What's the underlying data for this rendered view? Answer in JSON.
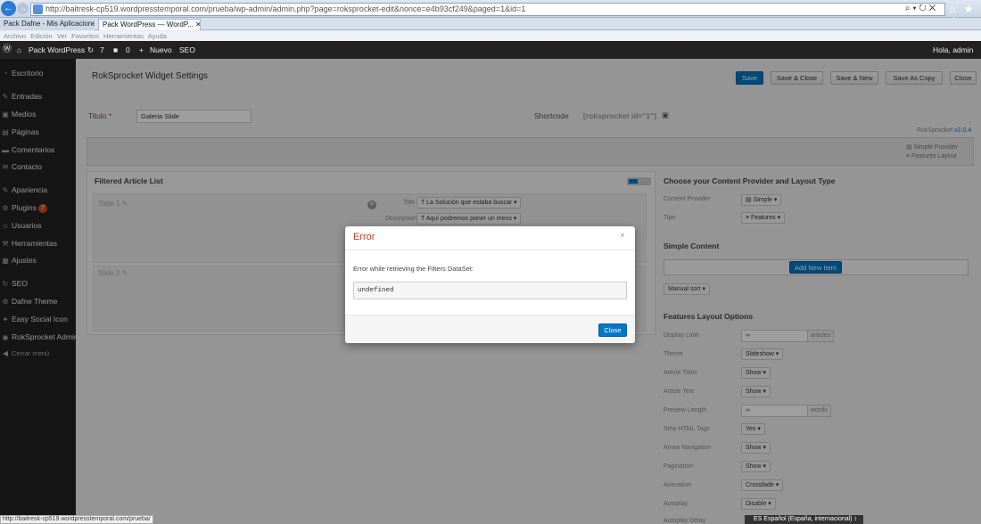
{
  "browser": {
    "url": "http://baitresk-cp519.wordpresstemporal.com/prueba/wp-admin/admin.php?page=roksprocket-edit&nonce=e4b93cf249&paged=1&id=1",
    "url_tools": "⌕ ▾ ↻ ✕",
    "right_icons": "⌂ ★ ⚙",
    "tabs": [
      {
        "label": "Pack Dafne - Mis Aplicaciones ..."
      },
      {
        "label": "Pack WordPress — WordP... ✕"
      }
    ],
    "menu": "Archivo Edición Ver Favoritos Herramientas Ayuda",
    "status_url": "http://baitresk-cp519.wordpresstemporal.com/prueba/"
  },
  "admin_bar": {
    "site_name": "Pack WordPress",
    "updates_count": "7",
    "comments_count": "0",
    "new_label": "Nuevo",
    "seo_label": "SEO",
    "greeting": "Hola, admin"
  },
  "sidebar": {
    "items": [
      {
        "label": "Escritorio",
        "icon": "◔"
      },
      {
        "label": "Entradas",
        "icon": "✎"
      },
      {
        "label": "Medios",
        "icon": "▣"
      },
      {
        "label": "Páginas",
        "icon": "▤"
      },
      {
        "label": "Comentarios",
        "icon": "▬"
      },
      {
        "label": "Contacto",
        "icon": "✉"
      },
      {
        "label": "Apariencia",
        "icon": "✎"
      },
      {
        "label": "Plugins",
        "icon": "⚙",
        "badge": "7"
      },
      {
        "label": "Usuarios",
        "icon": "☺"
      },
      {
        "label": "Herramientas",
        "icon": "⚒"
      },
      {
        "label": "Ajustes",
        "icon": "▦"
      },
      {
        "label": "SEO",
        "icon": "↻"
      },
      {
        "label": "Dafne Theme",
        "icon": "⚙"
      },
      {
        "label": "Easy Social Icon",
        "icon": "✦"
      },
      {
        "label": "RokSprocket Admin",
        "icon": "◉"
      },
      {
        "label": "Cerrar menú",
        "icon": "◀"
      }
    ]
  },
  "page": {
    "title": "RokSprocket Widget Settings",
    "buttons": {
      "save": "Save",
      "save_close": "Save & Close",
      "save_new": "Save & New",
      "save_copy": "Save As Copy",
      "close": "Close"
    },
    "title_label": "Titulo",
    "title_required": "*",
    "title_value": "Galeria Slide",
    "shortcode_label": "Shortcode",
    "shortcode_value": "[roksprocket id=\"1\"]",
    "version_brand": "RokSprocket",
    "version": "v2.0.4",
    "provider_badge": "Simple Provider",
    "layout_badge": "Features Layout"
  },
  "article_list": {
    "title": "Filtered Article List",
    "slides": [
      {
        "label": "Slide 1 ✎"
      },
      {
        "label": "Slide 2 ✎"
      }
    ],
    "title_field_label": "Title",
    "title_field_value": "T La Solución que estaba buscar ▾",
    "desc_field_label": "Description",
    "desc_field_value": "T Aquí podremos poner un mens ▾"
  },
  "content_provider": {
    "heading": "Choose your Content Provider and Layout Type",
    "provider_label": "Content Provider",
    "provider_value": "Simple ▾",
    "type_label": "Tipo",
    "type_value": "Features ▾",
    "simple_heading": "Simple Content",
    "add_item": "Add New Item",
    "sort": "Manual sort ▾"
  },
  "layout_options": {
    "heading": "Features Layout Options",
    "rows": [
      {
        "label": "Display Limit",
        "value": "∞",
        "addon": "articles"
      },
      {
        "label": "Theme",
        "value": "Slideshow ▾"
      },
      {
        "label": "Article Titles",
        "value": "Show ▾"
      },
      {
        "label": "Article Text",
        "value": "Show ▾"
      },
      {
        "label": "Preview Length",
        "value": "∞",
        "addon": "words"
      },
      {
        "label": "Strip HTML Tags",
        "value": "Yes ▾"
      },
      {
        "label": "Arrow Navigation",
        "value": "Show ▾"
      },
      {
        "label": "Pagination",
        "value": "Show ▾"
      },
      {
        "label": "Animation",
        "value": "Crossfade ▾"
      },
      {
        "label": "Autoplay",
        "value": "Disable ▾"
      },
      {
        "label": "Autoplay Delay",
        "value": ""
      }
    ]
  },
  "modal": {
    "title": "Error",
    "close_x": "×",
    "message": "Error while retrieving the Filters DataSet:",
    "code": "undefined",
    "close_button": "Close"
  },
  "language_selector": "ES Español (España, internacional) ↕",
  "colors": {
    "primary_button": "#0078c7",
    "error_title": "#c0392b",
    "admin_bar": "#222222",
    "badge": "#d54e21"
  }
}
